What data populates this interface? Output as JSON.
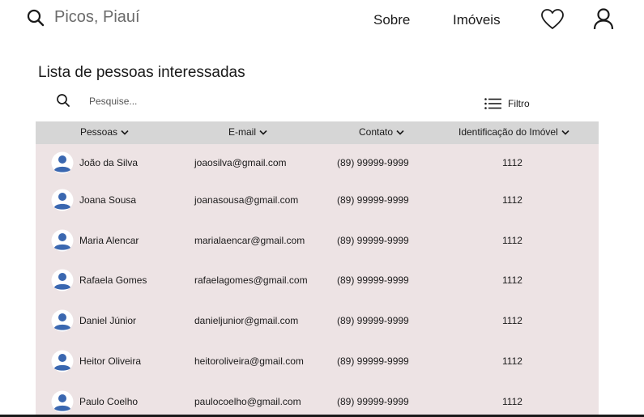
{
  "header": {
    "location": "Picos, Piauí",
    "nav": [
      "Sobre",
      "Imóveis"
    ]
  },
  "list": {
    "title": "Lista de pessoas interessadas",
    "search_placeholder": "Pesquise...",
    "filter_label": "Filtro"
  },
  "table": {
    "columns": [
      "Pessoas",
      "E-mail",
      "Contato",
      "Identificação do Imóvel"
    ],
    "rows": [
      {
        "name": "João da Silva",
        "email": "joaosilva@gmail.com",
        "phone": "(89) 99999-9999",
        "id": "1112"
      },
      {
        "name": "Joana Sousa",
        "email": "joanasousa@gmail.com",
        "phone": "(89) 99999-9999",
        "id": "1112"
      },
      {
        "name": "Maria Alencar",
        "email": "marialaencar@gmail.com",
        "phone": "(89) 99999-9999",
        "id": "1112"
      },
      {
        "name": "Rafaela Gomes",
        "email": "rafaelagomes@gmail.com",
        "phone": "(89) 99999-9999",
        "id": "1112"
      },
      {
        "name": "Daniel Júnior",
        "email": "danieljunior@gmail.com",
        "phone": "(89) 99999-9999",
        "id": "1112"
      },
      {
        "name": "Heitor Oliveira",
        "email": "heitoroliveira@gmail.com",
        "phone": "(89) 99999-9999",
        "id": "1112"
      },
      {
        "name": "Paulo Coelho",
        "email": "paulocoelho@gmail.com",
        "phone": "(89) 99999-9999",
        "id": "1112"
      }
    ]
  },
  "colors": {
    "table_bg": "#ede3e4",
    "header_bg": "#d6d6d6",
    "avatar_blue": "#3a67b0"
  },
  "icons": [
    "search-icon",
    "heart-icon",
    "user-icon",
    "filter-icon",
    "chevron-down-icon",
    "avatar-icon"
  ]
}
